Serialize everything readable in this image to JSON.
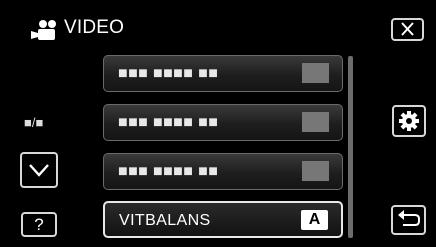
{
  "header": {
    "title": "VIDEO",
    "icon": "video-camera-icon"
  },
  "controls": {
    "close_icon": "close-icon",
    "settings_icon": "gear-icon",
    "back_icon": "return-icon",
    "down_icon": "chevron-down-icon",
    "help_label": "?",
    "page_indicator": "■/■"
  },
  "menu": {
    "items": [
      {
        "label": "■■■ ■■■■ ■■",
        "value": ""
      },
      {
        "label": "■■■ ■■■■ ■■",
        "value": ""
      },
      {
        "label": "■■■ ■■■■ ■■",
        "value": ""
      },
      {
        "label": "VITBALANS",
        "value": "A"
      }
    ]
  },
  "colors": {
    "accent": "#ffffff",
    "border": "#d8d8d8",
    "background": "#000000"
  }
}
